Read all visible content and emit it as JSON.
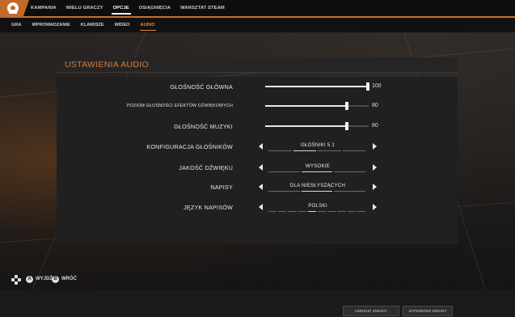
{
  "main_nav": {
    "items": [
      "KAMPANIA",
      "WIELU GRACZY",
      "OPCJE",
      "OSIĄGNIĘCIA",
      "WARSZTAT STEAM"
    ],
    "active_index": 2
  },
  "sub_nav": {
    "items": [
      "GRA",
      "WPROWADZANIE",
      "KLAWISZE",
      "WIDEO",
      "AUDIO"
    ],
    "active_index": 4
  },
  "panel": {
    "title": "USTAWIENIA AUDIO",
    "sliders": [
      {
        "label": "GŁOŚNOŚĆ GŁÓWNA",
        "value": "100",
        "level": 1.0
      },
      {
        "label": "POZIOM GŁOŚNOŚCI EFEKTÓW DŹWIĘKOWYCH",
        "value": "80",
        "level": 0.8
      },
      {
        "label": "GŁOŚNOŚĆ MUZYKI",
        "value": "80",
        "level": 0.8
      }
    ],
    "selectors": [
      {
        "label": "KONFIGURACJA GŁOŚNIKÓW",
        "value": "GŁOŚNIKI 5.1",
        "segments": 4,
        "selected": 2
      },
      {
        "label": "JAKOŚĆ DŹWIĘKU",
        "value": "WYSOKIE",
        "segments": 3,
        "selected": 2
      },
      {
        "label": "NAPISY",
        "value": "DLA NIESŁYSZĄCYCH",
        "segments": 3,
        "selected": 2
      },
      {
        "label": "JĘZYK NAPISÓW",
        "value": "POLSKI",
        "segments": 10,
        "selected": 5
      }
    ],
    "discard_label": "ODRZUĆ ZMIANY",
    "apply_label": "ZATWIERDŹ ZMIANY"
  },
  "footer": {
    "exit_label": "WYJDŹ",
    "back_label": "WRÓĆ",
    "exit_key": "A",
    "back_key": "B"
  },
  "colors": {
    "accent": "#e07b30",
    "topbar_accent": "#c8702a",
    "panel_bg": "#202020"
  }
}
